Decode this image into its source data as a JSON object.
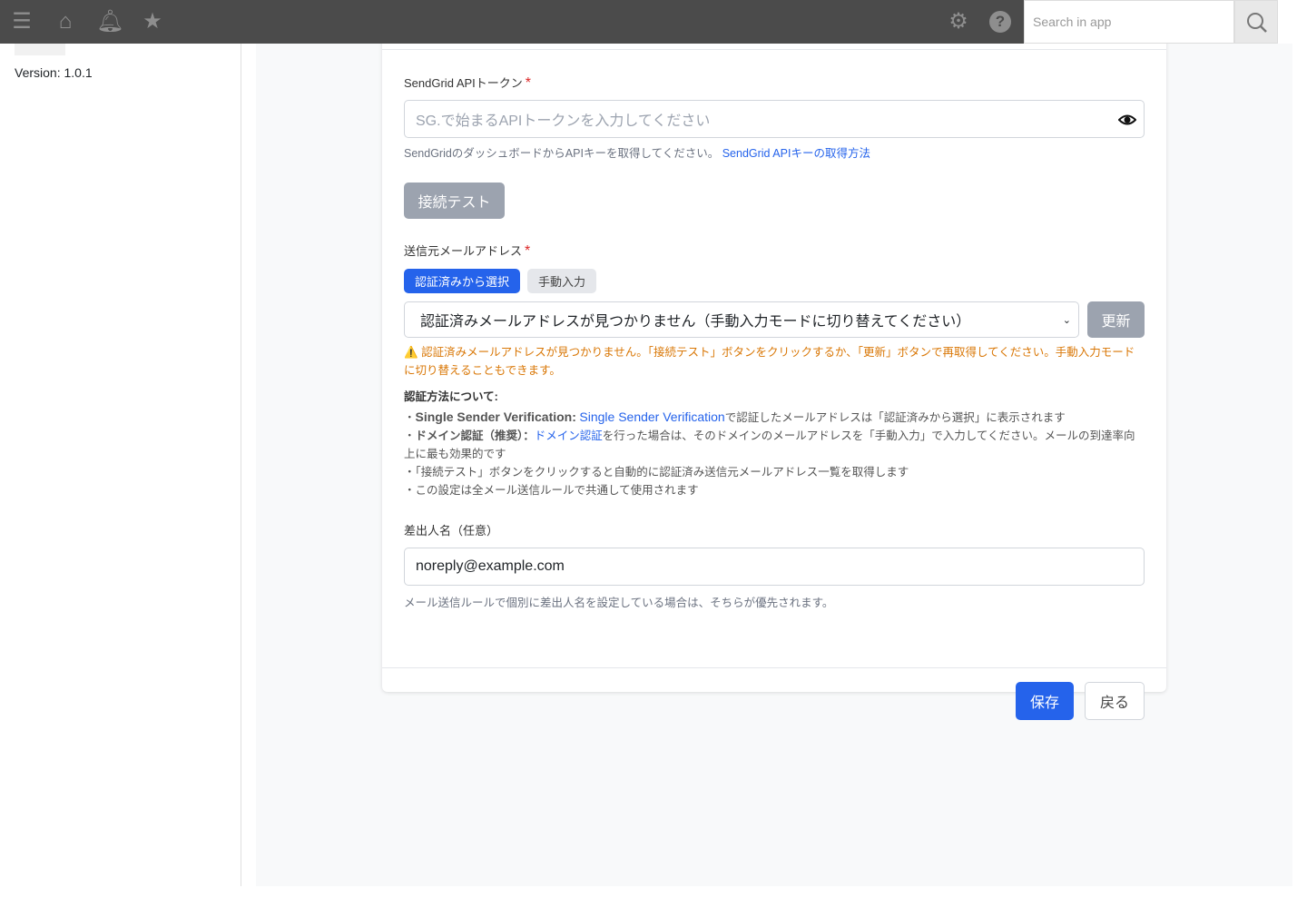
{
  "topbar": {
    "search_placeholder": "Search in app"
  },
  "sidebar": {
    "version": "Version: 1.0.1",
    "logo_text": "MAIL PLUGIN"
  },
  "form": {
    "token": {
      "label": "SendGrid APIトークン",
      "required": "*",
      "placeholder": "SG.で始まるAPIトークンを入力してください",
      "help": "SendGridのダッシュボードからAPIキーを取得してください。",
      "help_link": "SendGrid APIキーの取得方法"
    },
    "test_button": "接続テスト",
    "sender": {
      "label": "送信元メールアドレス",
      "required": "*",
      "mode_select": "認証済みから選択",
      "mode_manual": "手動入力",
      "selected": "認証済みメールアドレスが見つかりません（手動入力モードに切り替えてください）",
      "refresh": "更新",
      "warning": "認証済みメールアドレスが見つかりません。「接続テスト」ボタンをクリックするか、「更新」ボタンで再取得してください。手動入力モードに切り替えることもできます。"
    },
    "auth": {
      "heading": "認証方法について:",
      "n1_bold": "Single Sender Verification:",
      "n1_link": "Single Sender Verification",
      "n1_text": "で認証したメールアドレスは「認証済みから選択」に表示されます",
      "n2_bold": "ドメイン認証（推奨）：",
      "n2_link": "ドメイン認証",
      "n2_text": "を行った場合は、そのドメインのメールアドレスを「手動入力」で入力してください。メールの到達率向上に最も効果的です",
      "n3": "「接続テスト」ボタンをクリックすると自動的に認証済み送信元メールアドレス一覧を取得します",
      "n4": "この設定は全メール送信ルールで共通して使用されます"
    },
    "from_name": {
      "label": "差出人名（任意）",
      "value": "noreply@example.com",
      "help": "メール送信ルールで個別に差出人名を設定している場合は、そちらが優先されます。"
    },
    "save": "保存",
    "back": "戻る"
  },
  "colors": {
    "accent": "#2563eb",
    "warning": "#d97706"
  }
}
